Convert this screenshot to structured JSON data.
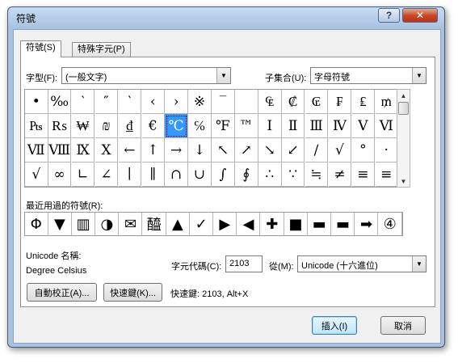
{
  "window": {
    "title": "符號",
    "help_glyph": "?",
    "close_glyph": "✕"
  },
  "tabs": [
    {
      "label": "符號(S)",
      "active": true
    },
    {
      "label": "特殊字元(P)",
      "active": false
    }
  ],
  "font": {
    "label": "字型(F):",
    "value": "(一般文字)"
  },
  "subset": {
    "label": "子集合(U):",
    "value": "字母符號"
  },
  "symbols": [
    [
      "•",
      "‰",
      "‵",
      "″",
      "‵",
      "‹",
      "›",
      "※",
      "‾",
      "",
      "₠",
      "₡",
      "₢",
      "₣",
      "₤",
      "₥",
      "₦"
    ],
    [
      "₧",
      "₨",
      "₩",
      "₪",
      "₫",
      "€",
      "℃",
      "℅",
      "℉",
      "™",
      "Ⅰ",
      "Ⅱ",
      "Ⅲ",
      "Ⅳ",
      "Ⅴ",
      "Ⅵ"
    ],
    [
      "Ⅶ",
      "Ⅷ",
      "Ⅸ",
      "Ⅹ",
      "←",
      "↑",
      "→",
      "↓",
      "↖",
      "↗",
      "↘",
      "↙",
      "∕",
      "√",
      "°",
      "·"
    ],
    [
      "√",
      "∞",
      "∟",
      "∠",
      "∣",
      "∥",
      "∩",
      "∪",
      "∫",
      "∮",
      "∴",
      "∵",
      "≒",
      "≠",
      "≡",
      "≡"
    ]
  ],
  "selected_symbol": {
    "row": 1,
    "col": 6
  },
  "recent": {
    "label": "最近用過的符號(R):",
    "items": [
      "Φ",
      "▼",
      "▥",
      "◑",
      "✉",
      "醯",
      "▲",
      "✓",
      "▶",
      "◀",
      "✚",
      "■",
      "▬",
      "▬",
      "➡",
      "④"
    ]
  },
  "unicode_name": {
    "label": "Unicode 名稱:",
    "value": "Degree Celsius"
  },
  "char_code": {
    "label": "字元代碼(C):",
    "value": "2103"
  },
  "from": {
    "label": "從(M):",
    "value": "Unicode (十六進位)"
  },
  "buttons": {
    "autocorrect": "自動校正(A)...",
    "shortcut_key": "快速鍵(K)...",
    "insert": "插入(I)",
    "cancel": "取消"
  },
  "shortcut_text": "快速鍵: 2103, Alt+X"
}
